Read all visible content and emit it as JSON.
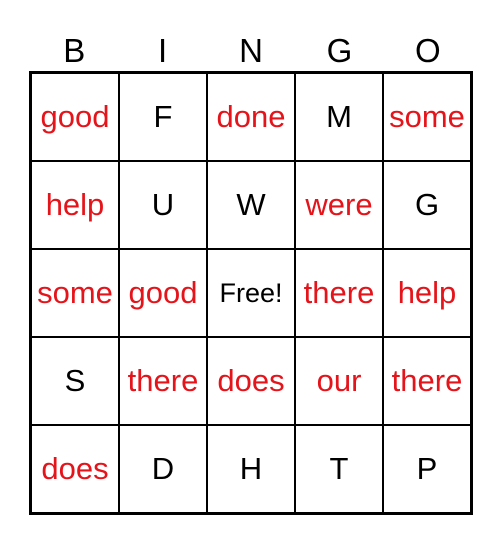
{
  "header": [
    "B",
    "I",
    "N",
    "G",
    "O"
  ],
  "colors": {
    "word": "#e5141b",
    "letter": "#000000"
  },
  "cells": [
    [
      "good",
      "F",
      "done",
      "M",
      "some"
    ],
    [
      "help",
      "U",
      "W",
      "were",
      "G"
    ],
    [
      "some",
      "good",
      "Free!",
      "there",
      "help"
    ],
    [
      "S",
      "there",
      "does",
      "our",
      "there"
    ],
    [
      "does",
      "D",
      "H",
      "T",
      "P"
    ]
  ]
}
